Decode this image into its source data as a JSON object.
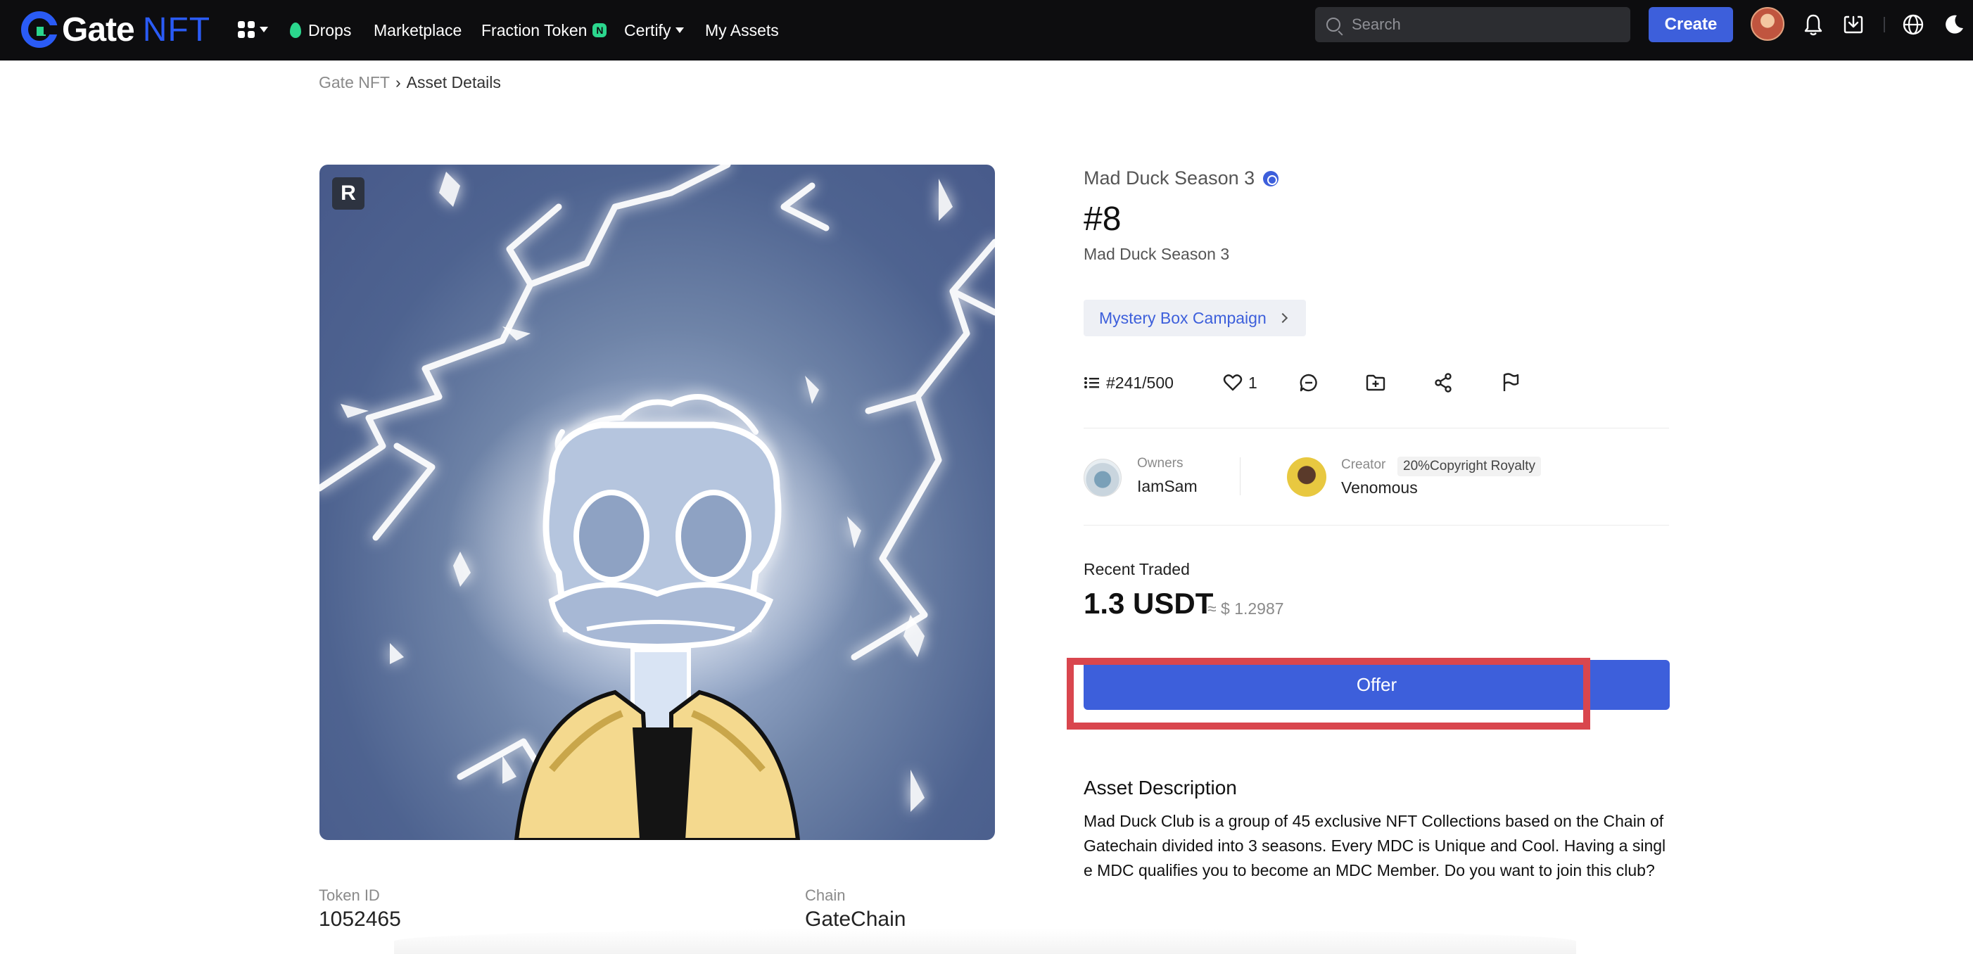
{
  "nav": {
    "logo_gate": "Gate",
    "logo_nft": "NFT",
    "items": [
      {
        "label": "Drops"
      },
      {
        "label": "Marketplace"
      },
      {
        "label": "Fraction Token",
        "badge": "N"
      },
      {
        "label": "Certify"
      },
      {
        "label": "My Assets"
      }
    ],
    "search_placeholder": "Search",
    "create_label": "Create",
    "icons": [
      "apps-grid-icon",
      "bell-icon",
      "download-icon",
      "globe-icon",
      "moon-icon"
    ]
  },
  "breadcrumb": {
    "home": "Gate NFT",
    "current": "Asset Details"
  },
  "artwork": {
    "badge": "R"
  },
  "asset": {
    "collection": "Mad Duck Season 3",
    "title": "#8",
    "subtitle": "Mad Duck Season 3",
    "campaign": "Mystery Box Campaign",
    "edition": "#241/500",
    "likes": "1"
  },
  "people": {
    "owners_label": "Owners",
    "owner_name": "IamSam",
    "creator_label": "Creator",
    "royalty": "20%Copyright Royalty",
    "creator_name": "Venomous"
  },
  "trade": {
    "recent_label": "Recent Traded",
    "price": "1.3 USDT",
    "price_usd": "≈ $ 1.2987",
    "offer_label": "Offer"
  },
  "description": {
    "title": "Asset Description",
    "body": "Mad Duck Club is a group of 45 exclusive NFT Collections based on the Chain of Gatechain divided into 3 seasons. Every MDC is Unique and Cool. Having a single MDC qualifies you to become an MDC Member. Do you want to join this club?"
  },
  "meta": {
    "token_id_label": "Token ID",
    "token_id": "1052465",
    "chain_label": "Chain",
    "chain": "GateChain"
  },
  "colors": {
    "accent": "#3d5fdb",
    "green": "#2bd68d",
    "highlight": "#d9464e",
    "topbar": "#0d0d0f"
  }
}
